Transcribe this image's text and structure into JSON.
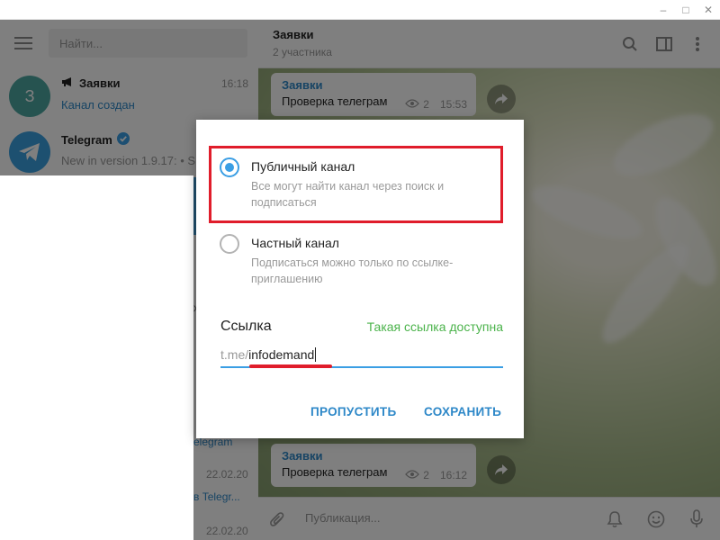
{
  "window": {
    "minimize": "–",
    "maximize": "□",
    "close": "✕"
  },
  "sidebar": {
    "search_placeholder": "Найти...",
    "chats": [
      {
        "avatar_letter": "З",
        "avatar_color": "#4da6a0",
        "name": "Заявки",
        "time": "16:18",
        "subtitle": "Канал создан",
        "subtitle_color": "#2e88c8"
      },
      {
        "avatar_letter": "",
        "avatar_color": "#3ba0e0",
        "name": "Telegram",
        "verified": true,
        "subtitle": "New in version 1.9.17: • S",
        "subtitle_color": "#999999"
      }
    ],
    "fragments": [
      {
        "text": "x"
      },
      {
        "text": "elegram"
      },
      {
        "text": "22.02.20"
      },
      {
        "text": "в Telegr..."
      },
      {
        "text": "22.02.20"
      }
    ]
  },
  "chat": {
    "title": "Заявки",
    "subtitle": "2 участника",
    "messages": [
      {
        "sender": "Заявки",
        "text": "Проверка телеграм",
        "views": "2",
        "time": "15:53"
      },
      {
        "sender": "Заявки",
        "text": "Проверка телеграм",
        "views": "2",
        "time": "16:12"
      }
    ],
    "composer_placeholder": "Публикация..."
  },
  "dialog": {
    "options": [
      {
        "title": "Публичный канал",
        "description": "Все могут найти канал через поиск и подписаться",
        "checked": true
      },
      {
        "title": "Частный канал",
        "description": "Подписаться можно только по ссылке-приглашению",
        "checked": false
      }
    ],
    "link_label": "Ссылка",
    "link_status": "Такая ссылка доступна",
    "link_prefix": "t.me/",
    "link_value": "infodemand",
    "skip_label": "ПРОПУСТИТЬ",
    "save_label": "СОХРАНИТЬ"
  },
  "colors": {
    "accent": "#3a9ee4",
    "highlight_red": "#e01d2b",
    "available_green": "#4bb34b"
  }
}
